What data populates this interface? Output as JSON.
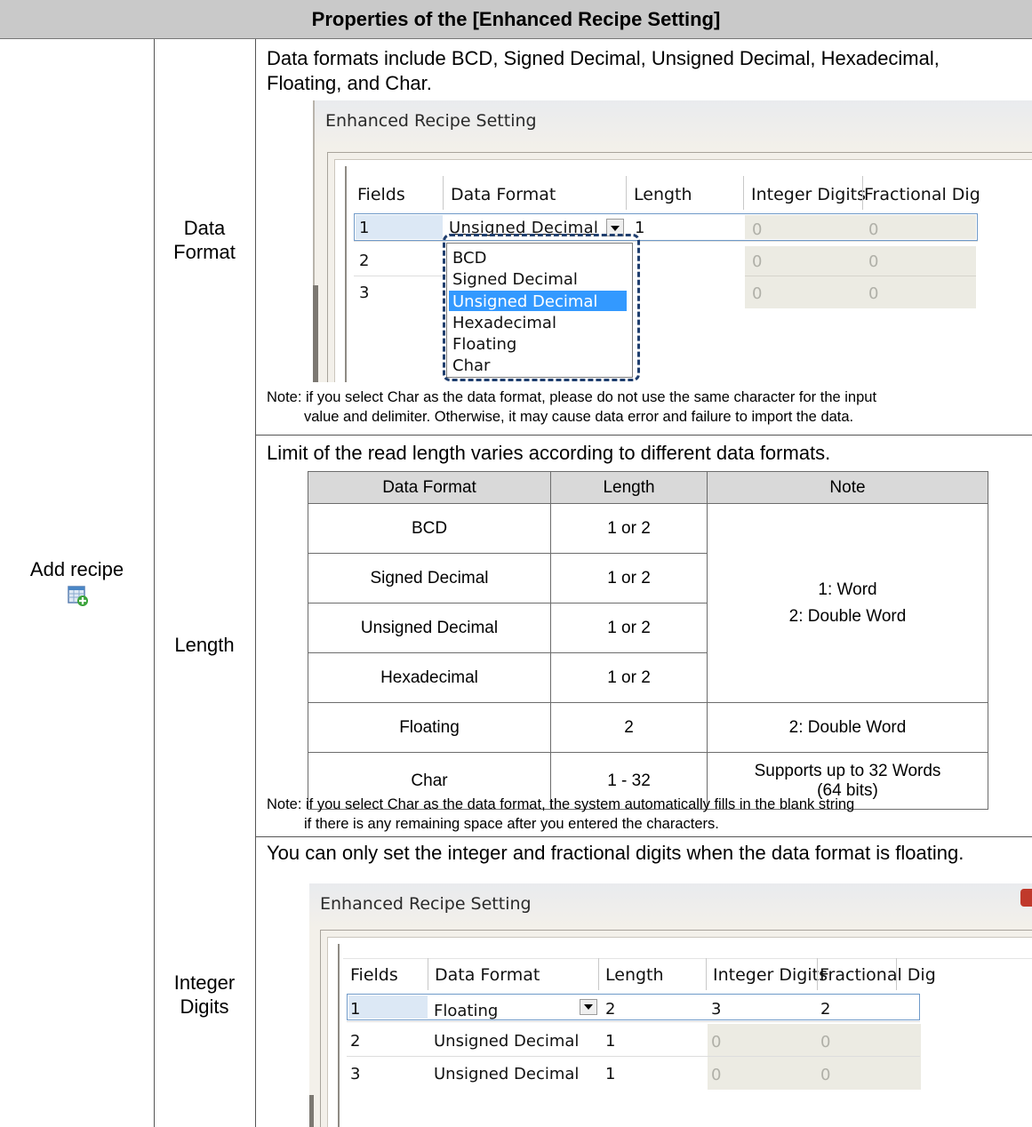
{
  "header": {
    "title": "Properties of the [Enhanced Recipe Setting]"
  },
  "left": {
    "label": "Add recipe",
    "icon": "add-recipe-icon"
  },
  "rows": {
    "data_format": {
      "label_line1": "Data",
      "label_line2": "Format",
      "desc_line1": "Data formats include BCD, Signed Decimal, Unsigned Decimal, Hexadecimal,",
      "desc_line2": "Floating, and Char.",
      "note_line1": "Note: if you select Char as the data format, please do not use the same character for the input",
      "note_line2": "value and delimiter. Otherwise, it may cause data error and failure to import the data."
    },
    "length": {
      "label": "Length",
      "desc": "Limit of the read length varies according to different data formats.",
      "note_line1": "Note: if you select Char as the data format, the system automatically fills in the blank string",
      "note_line2": "if there is any remaining space after you entered the characters."
    },
    "integer_digits": {
      "label_line1": "Integer",
      "label_line2": "Digits",
      "desc": "You can only set the integer and fractional digits when the data format is floating."
    }
  },
  "screenshot1": {
    "title": "Enhanced Recipe Setting",
    "columns": [
      "Fields",
      "Data Format",
      "Length",
      "Integer Digits",
      "Fractional Dig"
    ],
    "row1": {
      "field": "1",
      "format": "Unsigned Decimal",
      "length": "1",
      "int": "0",
      "frac": "0"
    },
    "row2": {
      "field": "2",
      "int": "0",
      "frac": "0"
    },
    "row3": {
      "field": "3",
      "int": "0",
      "frac": "0"
    },
    "dropdown_options": [
      "BCD",
      "Signed Decimal",
      "Unsigned Decimal",
      "Hexadecimal",
      "Floating",
      "Char"
    ],
    "selected_option": "Unsigned Decimal"
  },
  "screenshot2": {
    "title": "Enhanced Recipe Setting",
    "columns": [
      "Fields",
      "Data Format",
      "Length",
      "Integer Digits",
      "Fractional Dig"
    ],
    "rows": [
      {
        "field": "1",
        "format": "Floating",
        "length": "2",
        "int": "3",
        "frac": "2"
      },
      {
        "field": "2",
        "format": "Unsigned Decimal",
        "length": "1",
        "int": "0",
        "frac": "0"
      },
      {
        "field": "3",
        "format": "Unsigned Decimal",
        "length": "1",
        "int": "0",
        "frac": "0"
      }
    ]
  },
  "length_table": {
    "headers": [
      "Data Format",
      "Length",
      "Note"
    ],
    "rows": [
      {
        "format": "BCD",
        "length": "1 or 2"
      },
      {
        "format": "Signed Decimal",
        "length": "1 or 2"
      },
      {
        "format": "Unsigned Decimal",
        "length": "1 or 2"
      },
      {
        "format": "Hexadecimal",
        "length": "1 or 2"
      },
      {
        "format": "Floating",
        "length": "2",
        "note": "2: Double Word"
      },
      {
        "format": "Char",
        "length": "1 - 32",
        "note_line1": "Supports up to 32 Words",
        "note_line2": "(64 bits)"
      }
    ],
    "merged_note_line1": "1: Word",
    "merged_note_line2": "2: Double Word"
  }
}
